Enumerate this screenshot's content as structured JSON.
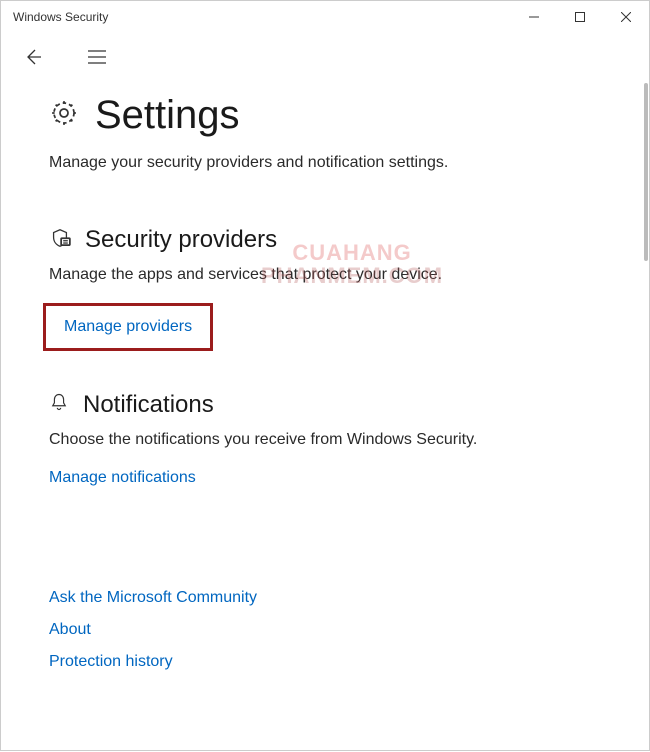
{
  "window": {
    "title": "Windows Security"
  },
  "page": {
    "title": "Settings",
    "subtitle": "Manage your security providers and notification settings."
  },
  "sections": {
    "providers": {
      "title": "Security providers",
      "desc": "Manage the apps and services that protect your device.",
      "link": "Manage providers"
    },
    "notifications": {
      "title": "Notifications",
      "desc": "Choose the notifications you receive from Windows Security.",
      "link": "Manage notifications"
    }
  },
  "footer_links": {
    "community": "Ask the Microsoft Community",
    "about": "About",
    "protection_history": "Protection history"
  },
  "watermark": {
    "line1": "CUAHANG",
    "line2": "PHANMEM.COM"
  }
}
